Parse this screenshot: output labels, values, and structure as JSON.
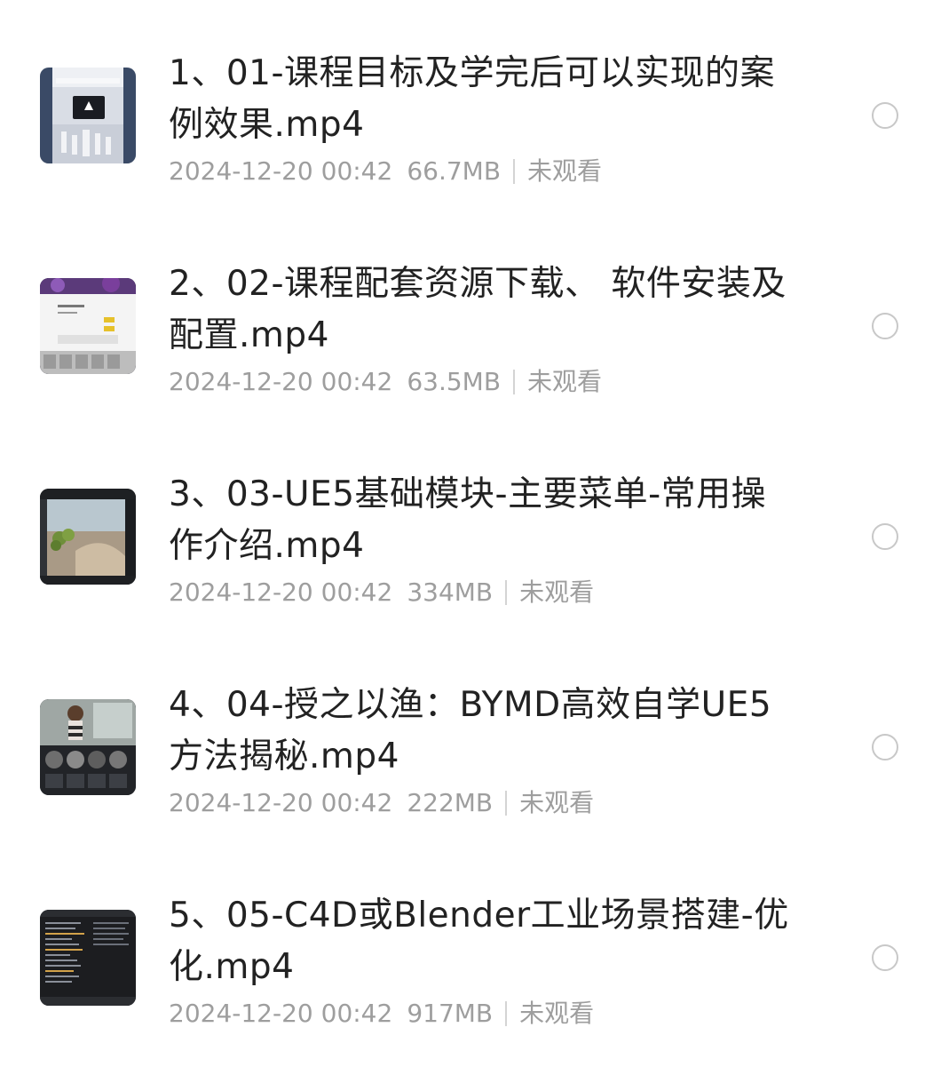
{
  "files": [
    {
      "title": "1、01-课程目标及学完后可以实现的案例效果.mp4",
      "date": "2024-12-20 00:42",
      "size": "66.7MB",
      "status": "未观看",
      "thumbnail": "film-thumbnail-showroom",
      "selected": false
    },
    {
      "title": "2、02-课程配套资源下载、 软件安装及配置.mp4",
      "date": "2024-12-20 00:42",
      "size": "63.5MB",
      "status": "未观看",
      "thumbnail": "film-thumbnail-download-dialog",
      "selected": false
    },
    {
      "title": "3、03-UE5基础模块-主要菜单-常用操作介绍.mp4",
      "date": "2024-12-20 00:42",
      "size": "334MB",
      "status": "未观看",
      "thumbnail": "film-thumbnail-ue5-viewport",
      "selected": false
    },
    {
      "title": "4、04-授之以渔：BYMD高效自学UE5方法揭秘.mp4",
      "date": "2024-12-20 00:42",
      "size": "222MB",
      "status": "未观看",
      "thumbnail": "film-thumbnail-content-browser",
      "selected": false
    },
    {
      "title": "5、05-C4D或Blender工业场景搭建-优化.mp4",
      "date": "2024-12-20 00:42",
      "size": "917MB",
      "status": "未观看",
      "thumbnail": "film-thumbnail-outliner",
      "selected": false
    }
  ],
  "colors": {
    "title": "#222222",
    "meta": "#9e9e9e",
    "radio_border": "#c8c8c8",
    "background": "#ffffff"
  }
}
